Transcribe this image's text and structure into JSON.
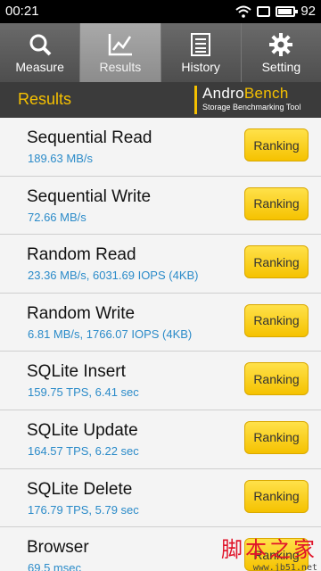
{
  "status_bar": {
    "time": "00:21",
    "battery": "92"
  },
  "tabs": [
    {
      "label": "Measure",
      "icon": "search-icon"
    },
    {
      "label": "Results",
      "icon": "chart-icon"
    },
    {
      "label": "History",
      "icon": "list-icon"
    },
    {
      "label": "Setting",
      "icon": "gear-icon"
    }
  ],
  "active_tab": "Results",
  "header": {
    "title": "Results",
    "logo_name_a": "Andro",
    "logo_name_b": "Bench",
    "logo_sub": "Storage Benchmarking Tool"
  },
  "results": [
    {
      "label": "Sequential Read",
      "value": "189.63 MB/s",
      "button": "Ranking"
    },
    {
      "label": "Sequential Write",
      "value": "72.66 MB/s",
      "button": "Ranking"
    },
    {
      "label": "Random Read",
      "value": "23.36 MB/s, 6031.69 IOPS (4KB)",
      "button": "Ranking"
    },
    {
      "label": "Random Write",
      "value": "6.81 MB/s, 1766.07 IOPS (4KB)",
      "button": "Ranking"
    },
    {
      "label": "SQLite Insert",
      "value": "159.75 TPS, 6.41 sec",
      "button": "Ranking"
    },
    {
      "label": "SQLite Update",
      "value": "164.57 TPS, 6.22 sec",
      "button": "Ranking"
    },
    {
      "label": "SQLite Delete",
      "value": "176.79 TPS, 5.79 sec",
      "button": "Ranking"
    },
    {
      "label": "Browser",
      "value": "69.5 msec",
      "button": "Ranking"
    }
  ],
  "watermark": {
    "text": "脚本之家",
    "url": "www.jb51.net"
  },
  "colors": {
    "accent": "#f5c000",
    "value_blue": "#2b8bc9",
    "header_bg": "#3b3b3b"
  }
}
